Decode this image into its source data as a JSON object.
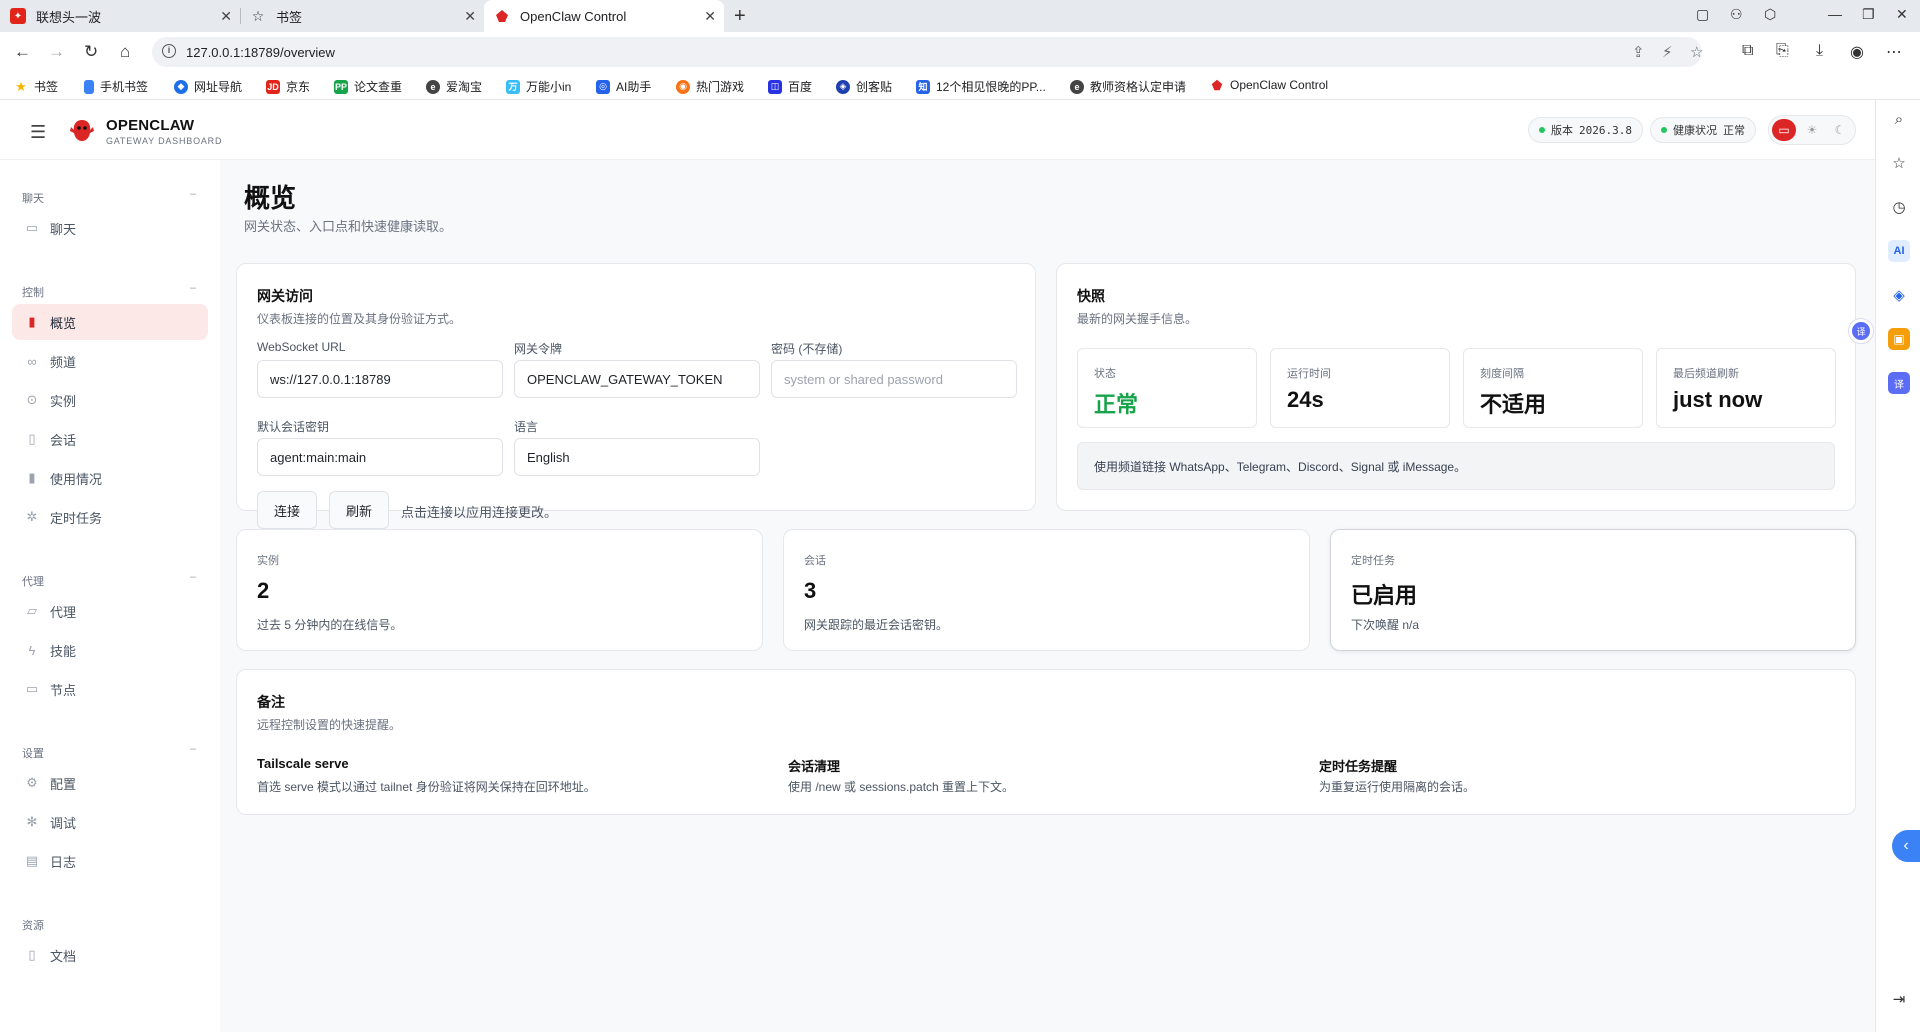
{
  "browser": {
    "tabs": [
      {
        "title": "联想头一波",
        "icon": "lenovo-icon"
      },
      {
        "title": "书签",
        "icon": "star-icon"
      },
      {
        "title": "OpenClaw Control",
        "icon": "openclaw-icon"
      }
    ],
    "url": "127.0.0.1:18789/overview",
    "bookmarks": [
      {
        "label": "书签",
        "color": "#f5b400"
      },
      {
        "label": "手机书签",
        "color": "#3b82f6"
      },
      {
        "label": "网址导航",
        "color": "#1d6fe8"
      },
      {
        "label": "京东",
        "color": "#e1251b"
      },
      {
        "label": "论文查重",
        "color": "#16a34a"
      },
      {
        "label": "爱淘宝",
        "color": "#555555"
      },
      {
        "label": "万能小in",
        "color": "#38bdf8"
      },
      {
        "label": "AI助手",
        "color": "#2563eb"
      },
      {
        "label": "热门游戏",
        "color": "#f97316"
      },
      {
        "label": "百度",
        "color": "#2932e1"
      },
      {
        "label": "创客贴",
        "color": "#1e40af"
      },
      {
        "label": "12个相见恨晚的PP...",
        "color": "#2563eb"
      },
      {
        "label": "教师资格认定申请",
        "color": "#555555"
      },
      {
        "label": "OpenClaw Control",
        "color": "#dc2626"
      }
    ]
  },
  "header": {
    "brand": "OPENCLAW",
    "brand_sub": "GATEWAY DASHBOARD",
    "version_label": "版本",
    "version_value": "2026.3.8",
    "health_label": "健康状况",
    "health_value": "正常"
  },
  "sidebar": {
    "sections": [
      {
        "title": "聊天",
        "items": [
          {
            "label": "聊天",
            "icon": "chat-icon"
          }
        ]
      },
      {
        "title": "控制",
        "items": [
          {
            "label": "概览",
            "icon": "bar-chart-icon"
          },
          {
            "label": "频道",
            "icon": "link-icon"
          },
          {
            "label": "实例",
            "icon": "broadcast-icon"
          },
          {
            "label": "会话",
            "icon": "document-icon"
          },
          {
            "label": "使用情况",
            "icon": "usage-icon"
          },
          {
            "label": "定时任务",
            "icon": "loader-icon"
          }
        ]
      },
      {
        "title": "代理",
        "items": [
          {
            "label": "代理",
            "icon": "folder-icon"
          },
          {
            "label": "技能",
            "icon": "bolt-icon"
          },
          {
            "label": "节点",
            "icon": "monitor-icon"
          }
        ]
      },
      {
        "title": "设置",
        "items": [
          {
            "label": "配置",
            "icon": "gear-icon"
          },
          {
            "label": "调试",
            "icon": "bug-icon"
          },
          {
            "label": "日志",
            "icon": "log-icon"
          }
        ]
      },
      {
        "title": "资源",
        "items": [
          {
            "label": "文档",
            "icon": "book-icon"
          }
        ]
      }
    ]
  },
  "page": {
    "title": "概览",
    "subtitle": "网关状态、入口点和快速健康读取。"
  },
  "gateway": {
    "title": "网关访问",
    "subtitle": "仪表板连接的位置及其身份验证方式。",
    "ws_label": "WebSocket URL",
    "ws_value": "ws://127.0.0.1:18789",
    "token_label": "网关令牌",
    "token_value": "OPENCLAW_GATEWAY_TOKEN",
    "password_label": "密码 (不存储)",
    "password_placeholder": "system or shared password",
    "session_label": "默认会话密钥",
    "session_value": "agent:main:main",
    "lang_label": "语言",
    "lang_value": "English",
    "connect": "连接",
    "refresh": "刷新",
    "hint": "点击连接以应用连接更改。"
  },
  "snapshot": {
    "title": "快照",
    "subtitle": "最新的网关握手信息。",
    "stats": [
      {
        "label": "状态",
        "value": "正常"
      },
      {
        "label": "运行时间",
        "value": "24s"
      },
      {
        "label": "刻度间隔",
        "value": "不适用"
      },
      {
        "label": "最后频道刷新",
        "value": "just now"
      }
    ],
    "note": "使用频道链接 WhatsApp、Telegram、Discord、Signal 或 iMessage。"
  },
  "metrics": [
    {
      "label": "实例",
      "value": "2",
      "desc": "过去 5 分钟内的在线信号。"
    },
    {
      "label": "会话",
      "value": "3",
      "desc": "网关跟踪的最近会话密钥。"
    },
    {
      "label": "定时任务",
      "value": "已启用",
      "desc": "下次唤醒 n/a"
    }
  ],
  "notes": {
    "title": "备注",
    "subtitle": "远程控制设置的快速提醒。",
    "cols": [
      {
        "title": "Tailscale serve",
        "desc": "首选 serve 模式以通过 tailnet 身份验证将网关保持在回环地址。"
      },
      {
        "title": "会话清理",
        "desc": "使用 /new 或 sessions.patch 重置上下文。"
      },
      {
        "title": "定时任务提醒",
        "desc": "为重复运行使用隔离的会话。"
      }
    ]
  },
  "colors": {
    "accent": "#dc2626",
    "ok": "#16a34a",
    "active_bg": "#fde8e8"
  }
}
